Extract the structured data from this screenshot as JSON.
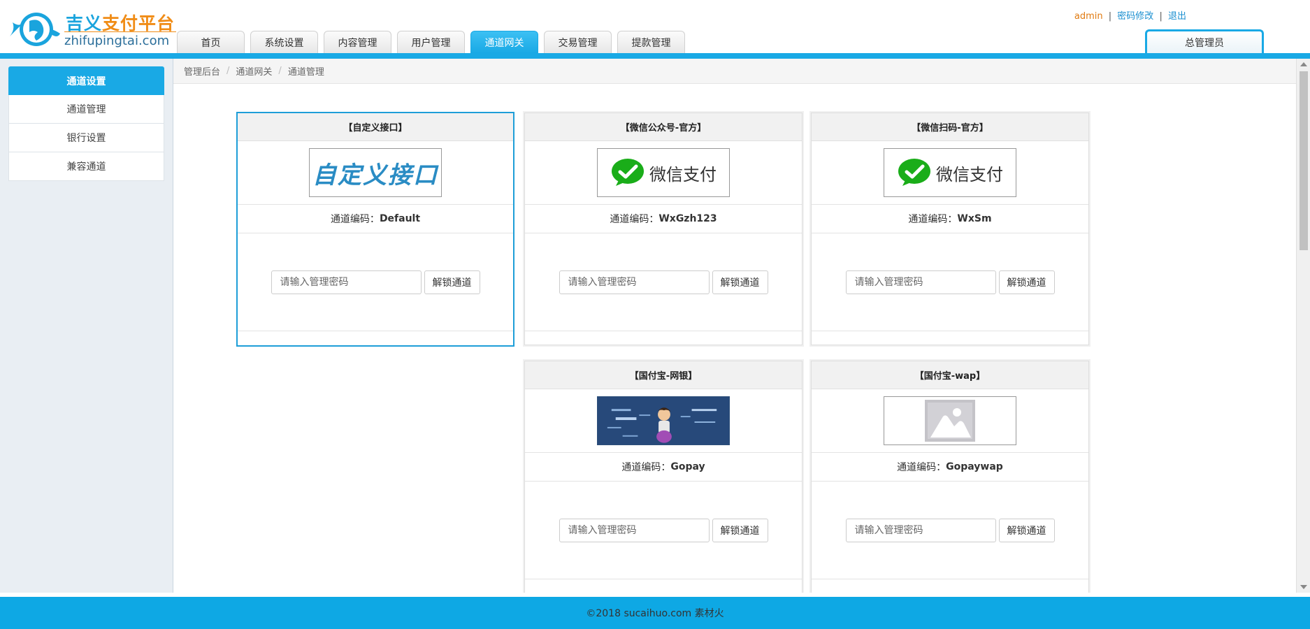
{
  "header": {
    "logo_title_part1": "吉义",
    "logo_title_part2": "支付平台",
    "logo_subtitle": "zhifupingtai.com",
    "nav_tabs": [
      "首页",
      "系统设置",
      "内容管理",
      "用户管理",
      "通道网关",
      "交易管理",
      "提款管理"
    ],
    "active_tab": "通道网关",
    "user": "admin",
    "separator": "|",
    "change_password": "密码修改",
    "logout": "退出",
    "role": "总管理员"
  },
  "sidebar": {
    "heading": "通道设置",
    "items": [
      "通道管理",
      "银行设置",
      "兼容通道"
    ]
  },
  "breadcrumb": [
    "管理后台",
    "通道网关",
    "通道管理"
  ],
  "breadcrumb_separator": "/",
  "channels": [
    {
      "title": "【自定义接口】",
      "image_text": "自定义接口",
      "code_label": "通道编码：",
      "code": "Default",
      "placeholder": "请输入管理密码",
      "button": "解锁通道",
      "icon": "custom-interface-logo"
    },
    {
      "title": "【微信公众号-官方】",
      "image_text": "微信支付",
      "code_label": "通道编码：",
      "code": "WxGzh123",
      "placeholder": "请输入管理密码",
      "button": "解锁通道",
      "icon": "wechat-pay-logo"
    },
    {
      "title": "【微信扫码-官方】",
      "image_text": "微信支付",
      "code_label": "通道编码：",
      "code": "WxSm",
      "placeholder": "请输入管理密码",
      "button": "解锁通道",
      "icon": "wechat-pay-logo"
    },
    {
      "title": "【国付宝-网银】",
      "code_label": "通道编码：",
      "code": "Gopay",
      "placeholder": "请输入管理密码",
      "button": "解锁通道",
      "icon": "gopay-banner-image"
    },
    {
      "title": "【国付宝-wap】",
      "code_label": "通道编码：",
      "code": "Gopaywap",
      "placeholder": "请输入管理密码",
      "button": "解锁通道",
      "icon": "image-placeholder-icon"
    }
  ],
  "footer": {
    "text": "©2018 sucaihuo.com 素材火"
  },
  "colors": {
    "primary": "#19a9e5",
    "orange": "#f08c16",
    "wechat_green": "#1aad19"
  }
}
